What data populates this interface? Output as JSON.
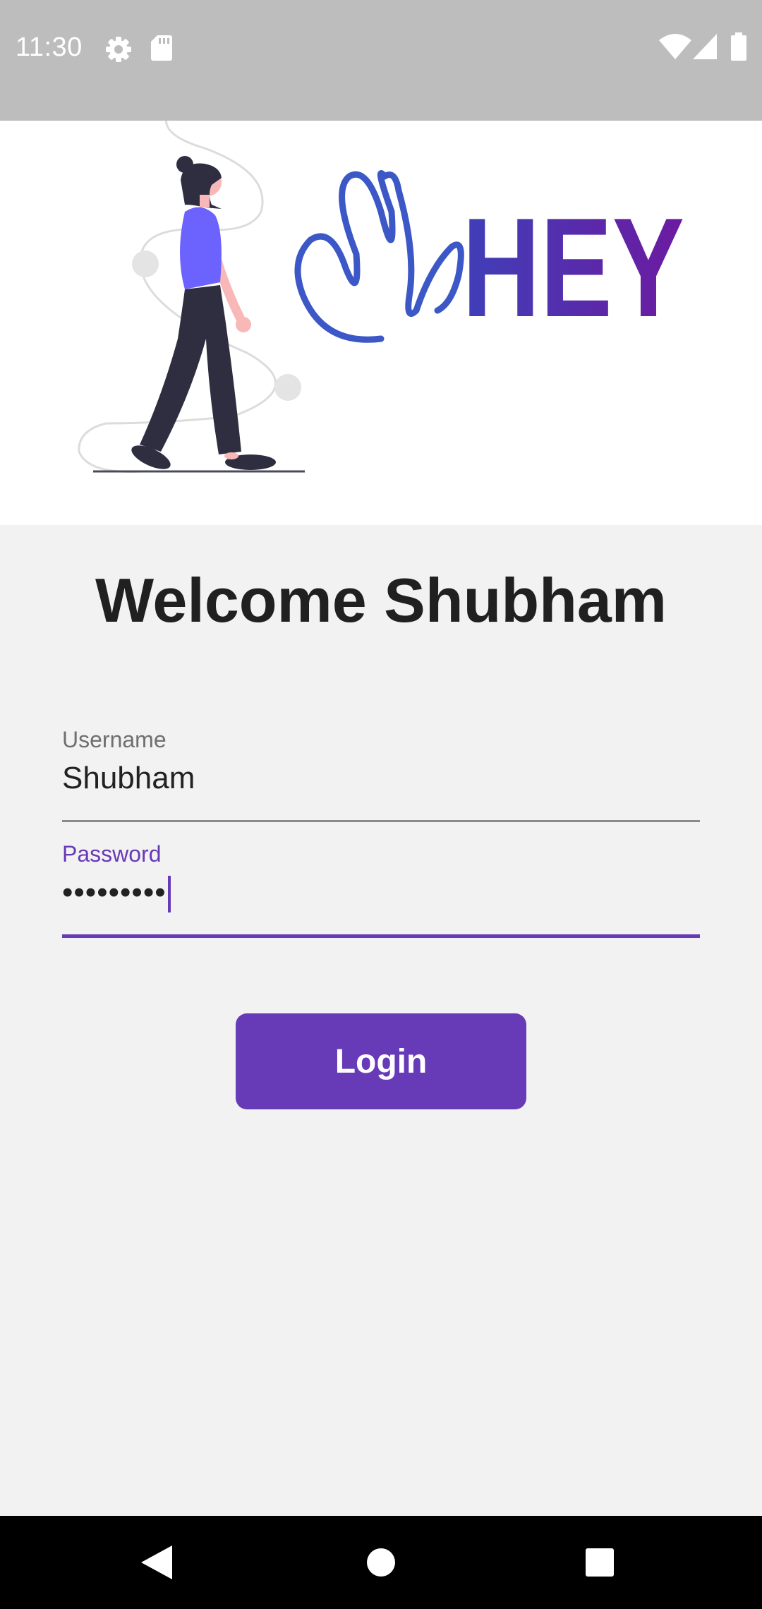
{
  "status_bar": {
    "time": "11:30",
    "icons": [
      "settings-icon",
      "sd-card-icon",
      "wifi-icon",
      "signal-icon",
      "battery-icon"
    ]
  },
  "hero": {
    "logo_text": "HEY",
    "illustration": "woman-walking-with-envelope"
  },
  "title": "Welcome Shubham",
  "form": {
    "username": {
      "label": "Username",
      "value": "Shubham"
    },
    "password": {
      "label": "Password",
      "value": "•••••••••"
    },
    "login_label": "Login"
  },
  "nav_bar": {
    "icons": [
      "back-icon",
      "home-icon",
      "recents-icon"
    ]
  },
  "colors": {
    "accent": "#673ab7",
    "status_bar": "#bdbdbd",
    "background": "#f3f2f3",
    "hero_background": "#ffffff"
  }
}
